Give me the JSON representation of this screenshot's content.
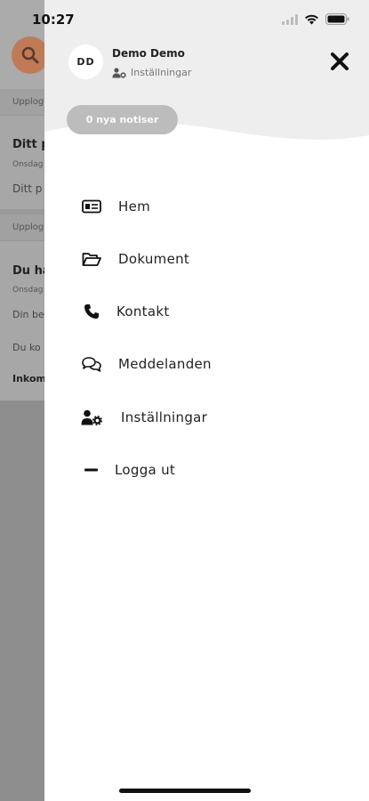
{
  "status_bar": {
    "time": "10:27",
    "icons": [
      "signal-icon",
      "wifi-icon",
      "battery-icon"
    ]
  },
  "background": {
    "sections": [
      {
        "header": "Upplog",
        "title": "Ditt p",
        "date": "Onsdag",
        "text": "Ditt p"
      },
      {
        "header": "Upplog",
        "title": "Du ha",
        "date": "Onsdag",
        "lines": [
          "Din be",
          "Du ko",
          "Inkom"
        ]
      }
    ],
    "accent": "#c07a58"
  },
  "drawer": {
    "user": {
      "initials": "DD",
      "name": "Demo Demo",
      "settings_label": "Inställningar"
    },
    "notice_label": "0 nya notiser",
    "menu": [
      {
        "label": "Hem",
        "icon": "id-card-icon"
      },
      {
        "label": "Dokument",
        "icon": "folder-open-icon"
      },
      {
        "label": "Kontakt",
        "icon": "phone-icon"
      },
      {
        "label": "Meddelanden",
        "icon": "chat-bubbles-icon"
      },
      {
        "label": "Inställningar",
        "icon": "user-gear-icon"
      },
      {
        "label": "Logga ut",
        "icon": "minus-icon"
      }
    ]
  }
}
